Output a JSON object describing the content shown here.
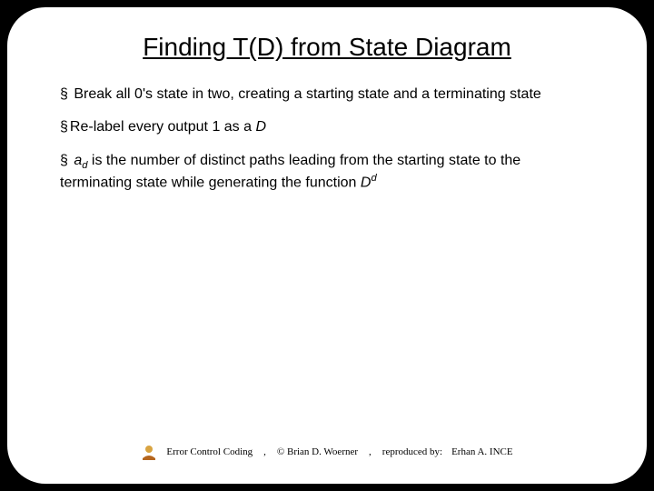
{
  "title": "Finding T(D) from State Diagram",
  "bullets": {
    "b1_pre": "Break all 0's state in two, creating a starting state and a terminating state",
    "b2_pre": "Re-label every output 1 as a ",
    "b2_ital": "D",
    "b3_a": "a",
    "b3_sub": "d",
    "b3_mid": " is the number of distinct paths leading from the starting state to the terminating state while generating the function ",
    "b3_D": "D",
    "b3_sup": "d"
  },
  "footer": {
    "course": "Error Control Coding",
    "author": "© Brian D. Woerner",
    "repro_label": "reproduced by:",
    "repro_name": "Erhan A. INCE",
    "sep": ","
  }
}
